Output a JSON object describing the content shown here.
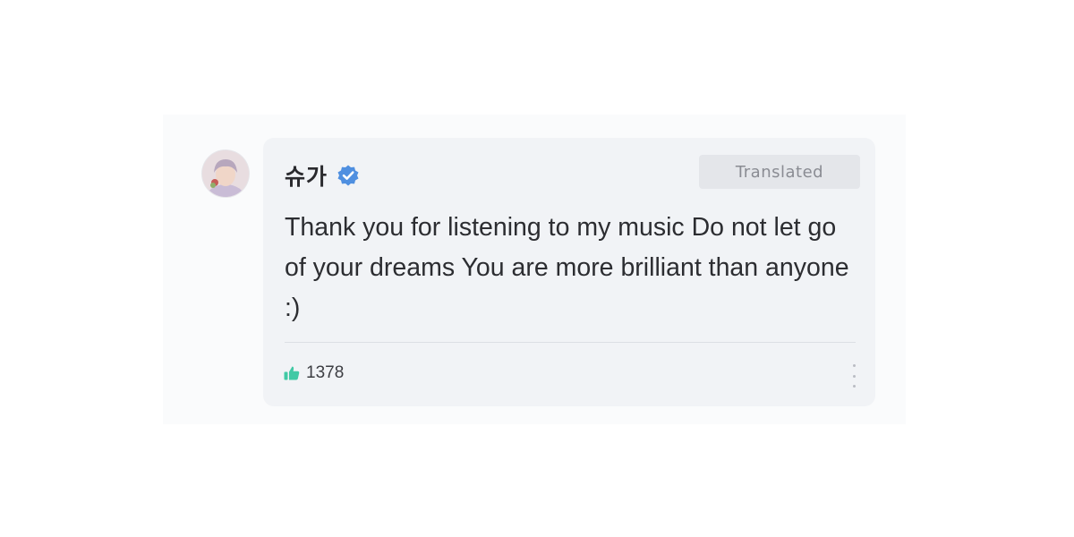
{
  "post": {
    "author": "슈가",
    "badge": "Translated",
    "message": "Thank you for listening to my music Do not let go of your dreams You are more brilliant than anyone :)",
    "likes": "1378"
  },
  "icons": {
    "avatar": "profile-photo",
    "verified": "verified-check-icon",
    "like": "thumbs-up-icon",
    "more": "vertical-ellipsis-icon"
  },
  "colors": {
    "verified": "#4f8fe0",
    "like": "#41c9a5",
    "card_bg": "#f1f3f6",
    "badge_bg": "#e4e6ea"
  }
}
